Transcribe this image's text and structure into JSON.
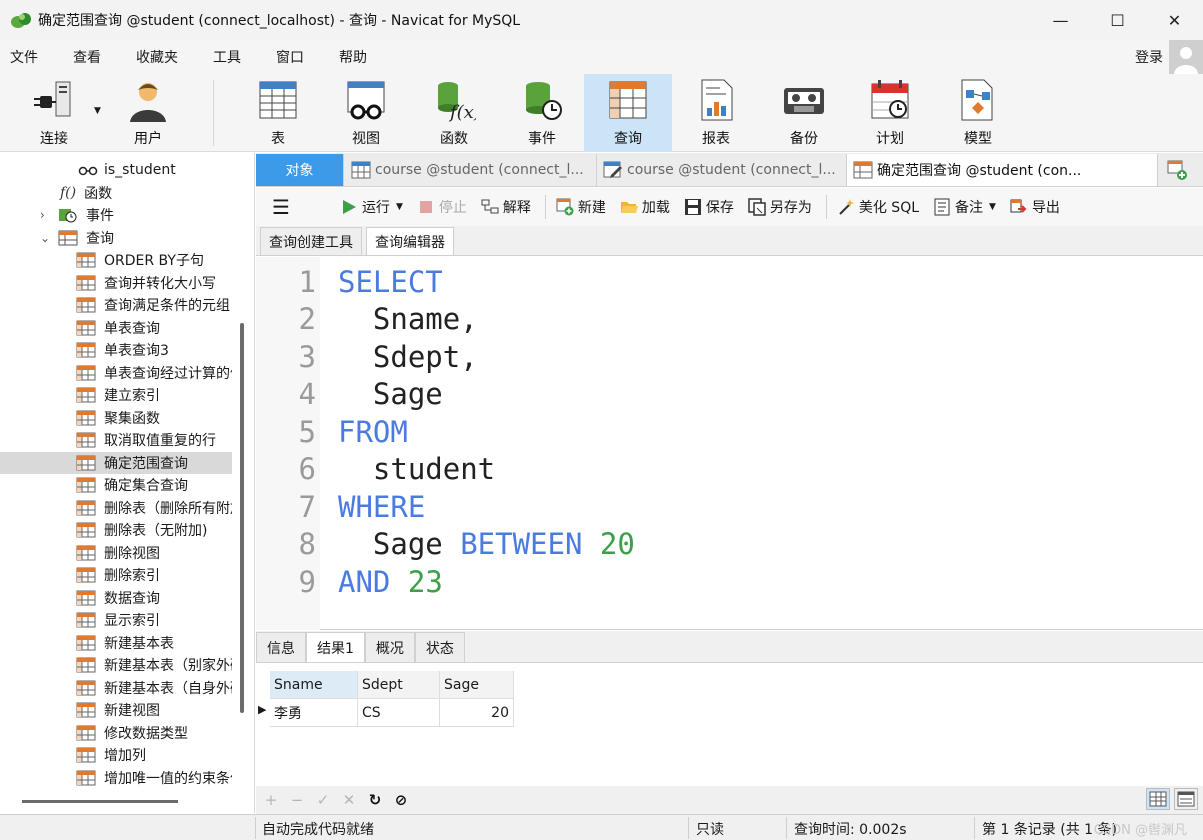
{
  "window": {
    "title": "确定范围查询 @student (connect_localhost) - 查询 - Navicat for MySQL",
    "minimize": "—",
    "maximize": "☐",
    "close": "✕"
  },
  "menu": [
    "文件",
    "查看",
    "收藏夹",
    "工具",
    "窗口",
    "帮助"
  ],
  "login": "登录",
  "toolbar": [
    "连接",
    "用户",
    "表",
    "视图",
    "函数",
    "事件",
    "查询",
    "报表",
    "备份",
    "计划",
    "模型"
  ],
  "sidebar": {
    "view_item": "is_student",
    "functions": "函数",
    "events": "事件",
    "queries": "查询",
    "items": [
      "ORDER BY子句",
      "查询并转化大小写",
      "查询满足条件的元组",
      "单表查询",
      "单表查询3",
      "单表查询经过计算的值",
      "建立索引",
      "聚集函数",
      "取消取值重复的行",
      "确定范围查询",
      "确定集合查询",
      "删除表（删除所有附加）",
      "删除表（无附加)",
      "删除视图",
      "删除索引",
      "数据查询",
      "显示索引",
      "新建基本表",
      "新建基本表（别家外码）",
      "新建基本表（自身外码）",
      "新建视图",
      "修改数据类型",
      "增加列",
      "增加唯一值的约束条件"
    ],
    "selected": "确定范围查询"
  },
  "tabs": {
    "objects": "对象",
    "tab1": "course @student (connect_l...",
    "tab2": "course @student (connect_l...",
    "tab3": "确定范围查询 @student (con..."
  },
  "editor_toolbar": {
    "run": "运行",
    "stop": "停止",
    "explain": "解释",
    "new": "新建",
    "load": "加载",
    "save": "保存",
    "save_as": "另存为",
    "beautify": "美化 SQL",
    "note": "备注",
    "export": "导出"
  },
  "subtabs": [
    "查询创建工具",
    "查询编辑器"
  ],
  "code": [
    {
      "n": "1",
      "kw": "SELECT",
      "id": "",
      "num": ""
    },
    {
      "n": "2",
      "kw": "",
      "id": "  Sname,",
      "num": ""
    },
    {
      "n": "3",
      "kw": "",
      "id": "  Sdept,",
      "num": ""
    },
    {
      "n": "4",
      "kw": "",
      "id": "  Sage",
      "num": ""
    },
    {
      "n": "5",
      "kw": "FROM",
      "id": "",
      "num": ""
    },
    {
      "n": "6",
      "kw": "",
      "id": "  student",
      "num": ""
    },
    {
      "n": "7",
      "kw": "WHERE",
      "id": "",
      "num": ""
    },
    {
      "n": "8",
      "kw": "BETWEEN",
      "id": "  Sage ",
      "num": "20"
    },
    {
      "n": "9",
      "kw": "AND",
      "id": "",
      "num": "23"
    }
  ],
  "result_tabs": [
    "信息",
    "结果1",
    "概况",
    "状态"
  ],
  "grid": {
    "columns": [
      "Sname",
      "Sdept",
      "Sage"
    ],
    "rows": [
      [
        "李勇",
        "CS",
        "20"
      ]
    ]
  },
  "bottom_icons": [
    "+",
    "−",
    "✓",
    "✕",
    "↻",
    "⊘"
  ],
  "status": {
    "autocomplete": "自动完成代码就绪",
    "readonly": "只读",
    "query_time": "查询时间: 0.002s",
    "records": "第 1 条记录 (共 1 条)",
    "watermark": "CSDN @辔渊凡"
  },
  "colors": {
    "accent": "#3c9ae8",
    "keyword": "#4a7ce0",
    "number": "#3aa04a"
  }
}
